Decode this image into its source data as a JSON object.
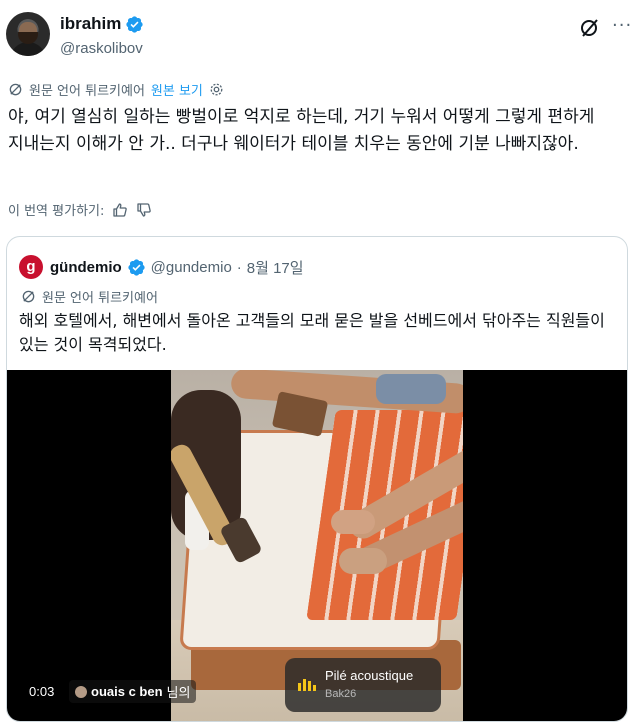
{
  "tweet": {
    "display_name": "ibrahim",
    "handle": "@raskolibov",
    "translated_label": "원문 언어 튀르키예어",
    "show_original": "원본 보기",
    "text": "야, 여기 열심히 일하는 빵벌이로 억지로 하는데, 거기 누워서 어떻게 그렇게 편하게 지내는지 이해가 안 가.. 더구나 웨이터가 테이블 치우는 동안에 기분 나빠지잖아.",
    "rate_label": "이 번역 평가하기:"
  },
  "quote": {
    "display_name": "gündemio",
    "handle": "@gundemio",
    "separator": "·",
    "date": "8월 17일",
    "avatar_letter": "g",
    "translated_label": "원문 언어 튀르키예어",
    "text": "해외 호텔에서, 해변에서 돌아온 고객들의 모래 묻은 발을 선베드에서 닦아주는 직원들이 있는 것이 목격되었다."
  },
  "video": {
    "time": "0:03",
    "caption_user": "ouais c ben",
    "caption_suffix": "님의",
    "music_title": "Pilé acoustique",
    "music_artist": "Bak26"
  },
  "colors": {
    "accent": "#1d9bf0",
    "text_primary": "#0f1419",
    "text_secondary": "#536471",
    "verified_badge": "#1d9bf0",
    "quote_avatar": "#c8102e"
  },
  "icons": {
    "verified": "verified-badge-icon",
    "grok": "grok-icon",
    "more": "more-icon",
    "translate": "translate-icon",
    "settings": "gear-icon",
    "thumbs_up": "thumbs-up-icon",
    "thumbs_down": "thumbs-down-icon",
    "music": "music-bars-icon"
  }
}
